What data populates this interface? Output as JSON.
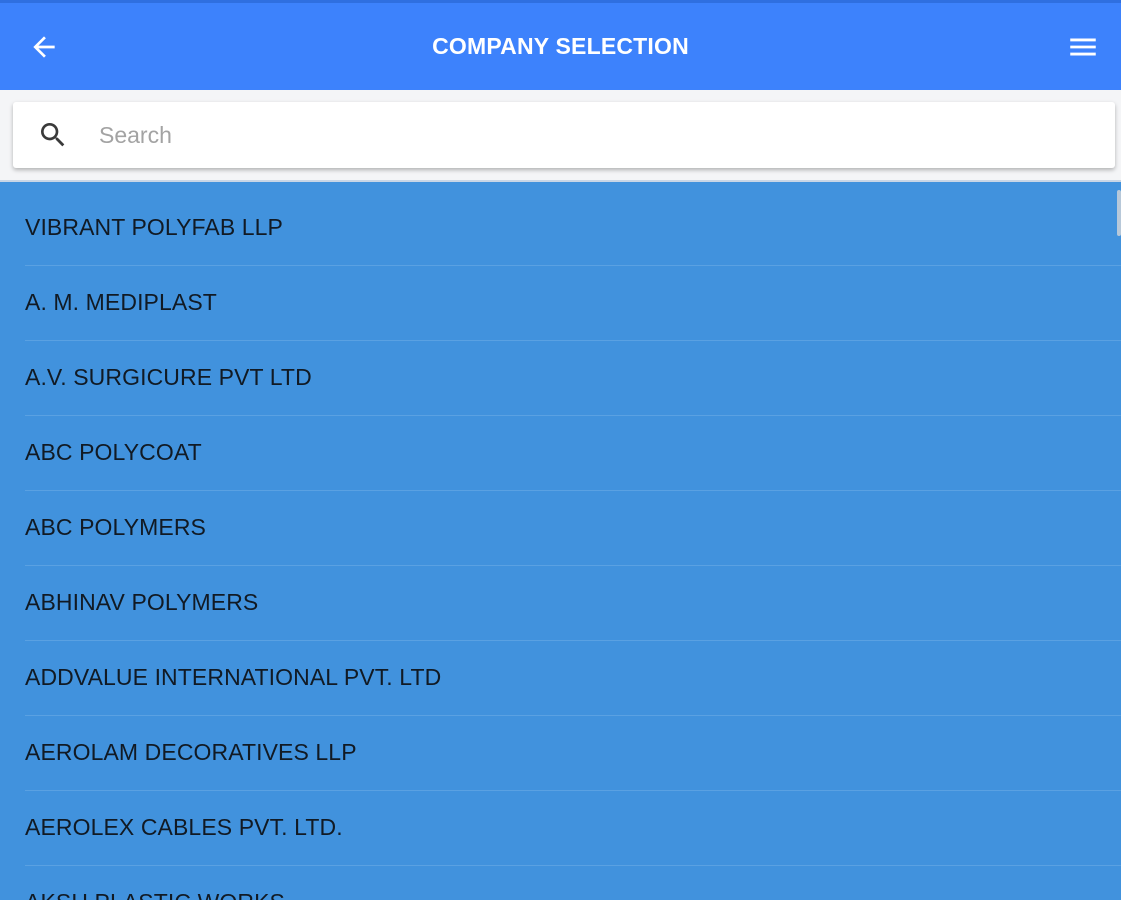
{
  "header": {
    "title": "COMPANY SELECTION",
    "back_icon": "arrow-left-icon",
    "menu_icon": "hamburger-menu-icon",
    "color": "#3d82fc"
  },
  "search": {
    "placeholder": "Search",
    "value": "",
    "icon": "search-icon"
  },
  "list": {
    "background": "#4192dd",
    "items": [
      {
        "label": "VIBRANT POLYFAB LLP"
      },
      {
        "label": "A. M. MEDIPLAST"
      },
      {
        "label": "A.V. SURGICURE PVT LTD"
      },
      {
        "label": "ABC POLYCOAT"
      },
      {
        "label": "ABC POLYMERS"
      },
      {
        "label": "ABHINAV POLYMERS"
      },
      {
        "label": "ADDVALUE INTERNATIONAL PVT. LTD"
      },
      {
        "label": "AEROLAM DECORATIVES LLP"
      },
      {
        "label": "AEROLEX CABLES PVT. LTD."
      },
      {
        "label": "AKSH PLASTIC WORKS"
      }
    ]
  }
}
